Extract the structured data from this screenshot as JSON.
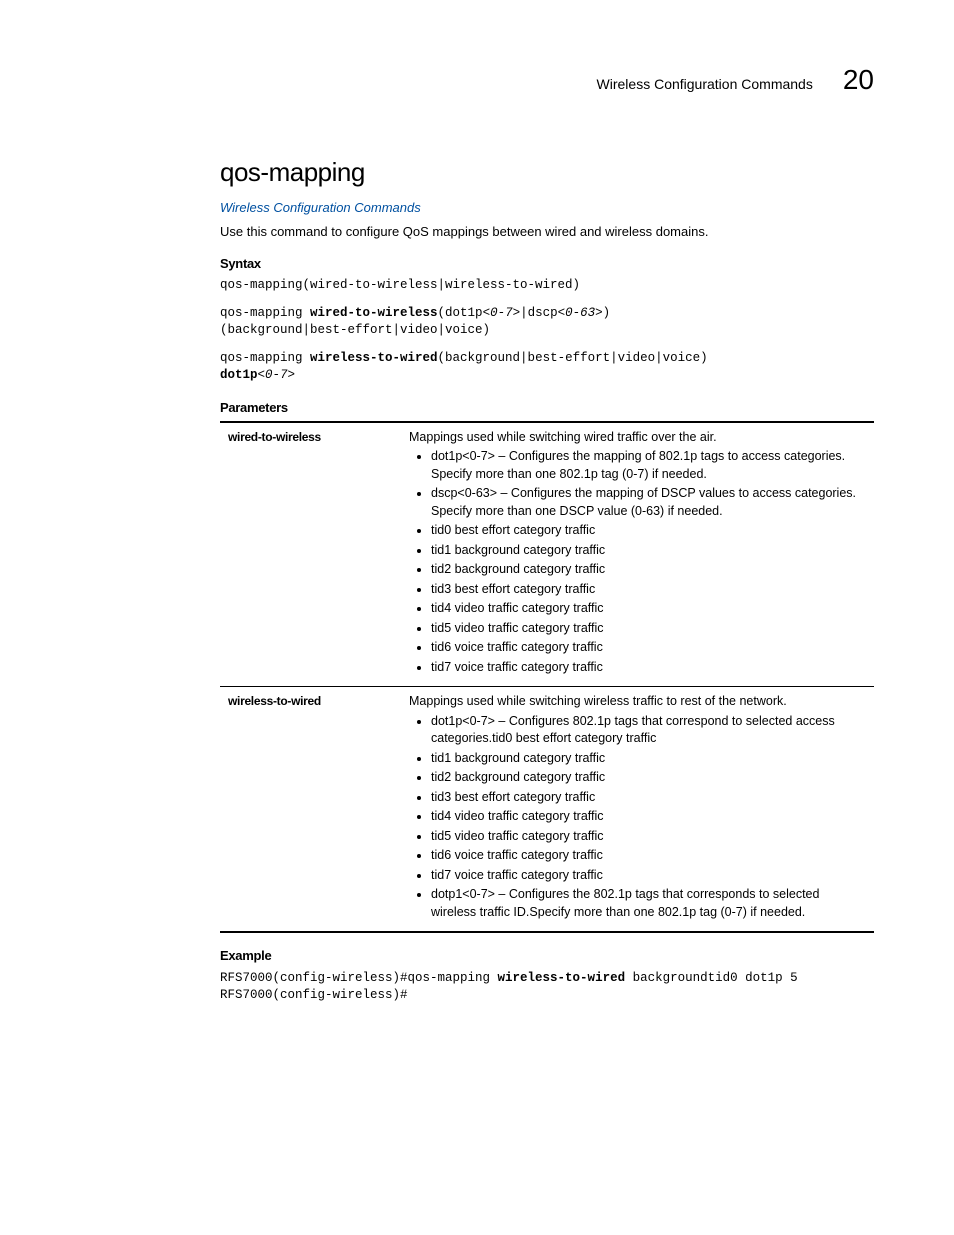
{
  "header": {
    "title": "Wireless Configuration Commands",
    "num": "20"
  },
  "section": {
    "title": "qos-mapping",
    "link": "Wireless Configuration Commands",
    "desc": "Use this command to configure QoS mappings between wired and wireless domains."
  },
  "syntax": {
    "heading": "Syntax",
    "line1": "qos-mapping(wired-to-wireless|wireless-to-wired)",
    "line2a": "qos-mapping ",
    "line2b": "wired-to-wireless",
    "line2c": "(dot1p",
    "line2d": "<0-7>",
    "line2e": "|dscp",
    "line2f": "<0-63>",
    "line2g": ")",
    "line2h": "(background|best-effort|video|voice)",
    "line3a": "qos-mapping ",
    "line3b": "wireless-to-wired",
    "line3c": "(background|best-effort|video|voice)",
    "line3d": "dot1p",
    "line3e": "<0-7>"
  },
  "params": {
    "heading": "Parameters",
    "rows": [
      {
        "name": "wired-to-wireless",
        "intro": "Mappings used while switching wired traffic over the air.",
        "bullets": [
          "dot1p<0-7> – Configures the mapping of 802.1p tags to access categories. Specify more than one 802.1p tag (0-7) if needed.",
          "dscp<0-63> – Configures the mapping of DSCP values to access categories. Specify more than one DSCP value (0-63) if needed.",
          "tid0  best effort category traffic",
          "tid1  background category traffic",
          "tid2  background category traffic",
          "tid3  best effort category traffic",
          "tid4  video traffic category traffic",
          "tid5  video traffic category traffic",
          "tid6  voice traffic category traffic",
          "tid7  voice traffic category traffic"
        ]
      },
      {
        "name": "wireless-to-wired",
        "intro": "Mappings used while switching wireless traffic to rest of the network.",
        "bullets": [
          "dot1p<0-7> – Configures 802.1p tags that correspond to selected access categories.tid0  best effort category traffic",
          "tid1  background category traffic",
          "tid2  background category traffic",
          "tid3  best effort category traffic",
          "tid4  video traffic category traffic",
          "tid5  video traffic category traffic",
          "tid6  voice traffic category traffic",
          "tid7  voice traffic category traffic",
          "dotp1<0-7> – Configures the 802.1p tags that corresponds to selected wireless traffic ID.Specify more than one 802.1p tag (0-7) if needed."
        ]
      }
    ]
  },
  "example": {
    "heading": "Example",
    "l1a": "RFS7000(config-wireless)#qos-mapping ",
    "l1b": "wireless-to-wired",
    "l1c": " backgroundtid0 dot1p 5",
    "l2": "RFS7000(config-wireless)#"
  }
}
